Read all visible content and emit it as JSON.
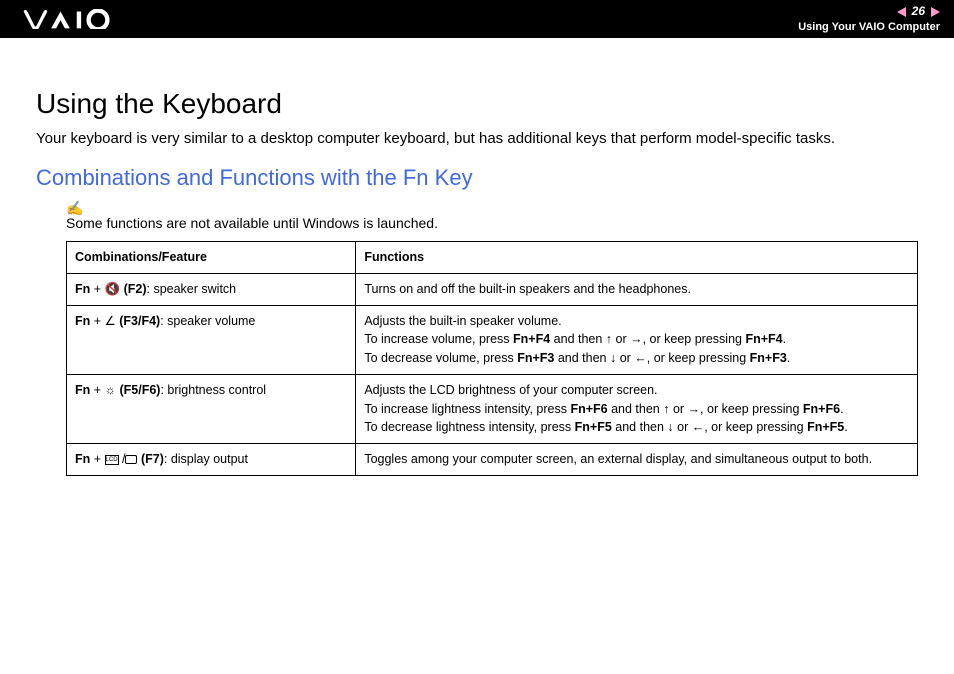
{
  "header": {
    "page_number": "26",
    "section": "Using Your VAIO Computer"
  },
  "content": {
    "title": "Using the Keyboard",
    "intro": "Your keyboard is very similar to a desktop computer keyboard, but has additional keys that perform model-specific tasks.",
    "subtitle": "Combinations and Functions with the Fn Key",
    "note": "Some functions are not available until Windows is launched.",
    "table": {
      "head": {
        "col1": "Combinations/Feature",
        "col2": "Functions"
      },
      "rows": [
        {
          "fn": "Fn",
          "plus": " + ",
          "icon_name": "speaker-mute-icon",
          "glyph": "🔇",
          "key": " (F2)",
          "desc": ": speaker switch",
          "func": "Turns on and off the built-in speakers and the headphones."
        },
        {
          "fn": "Fn",
          "plus": " + ",
          "icon_name": "speaker-volume-icon",
          "glyph": "∠",
          "key": " (F3/F4)",
          "desc": ": speaker volume",
          "func_lines": [
            "Adjusts the built-in speaker volume.",
            {
              "pre": "To increase volume, press ",
              "b1": "Fn+F4",
              "mid1": " and then ",
              "up": true,
              "mid2": " or ",
              "right": true,
              "mid3": ", or keep pressing ",
              "b2": "Fn+F4",
              "end": "."
            },
            {
              "pre": "To decrease volume, press ",
              "b1": "Fn+F3",
              "mid1": " and then ",
              "down": true,
              "mid2": " or ",
              "left": true,
              "mid3": ", or keep pressing ",
              "b2": "Fn+F3",
              "end": "."
            }
          ]
        },
        {
          "fn": "Fn",
          "plus": " + ",
          "icon_name": "brightness-icon",
          "glyph": "☼",
          "key": " (F5/F6)",
          "desc": ": brightness control",
          "func_lines": [
            "Adjusts the LCD brightness of your computer screen.",
            {
              "pre": "To increase lightness intensity, press ",
              "b1": "Fn+F6",
              "mid1": " and then ",
              "up": true,
              "mid2": " or ",
              "right": true,
              "mid3": ", or keep pressing ",
              "b2": "Fn+F6",
              "end": "."
            },
            {
              "pre": "To decrease lightness intensity, press ",
              "b1": "Fn+F5",
              "mid1": " and then ",
              "down": true,
              "mid2": " or ",
              "left": true,
              "mid3": ", or keep pressing ",
              "b2": "Fn+F5",
              "end": "."
            }
          ]
        },
        {
          "fn": "Fn",
          "plus": " + ",
          "icon_name": "display-output-icon",
          "key": " (F7)",
          "desc": ": display output",
          "func": "Toggles among your computer screen, an external display, and simultaneous output to both."
        }
      ]
    }
  }
}
